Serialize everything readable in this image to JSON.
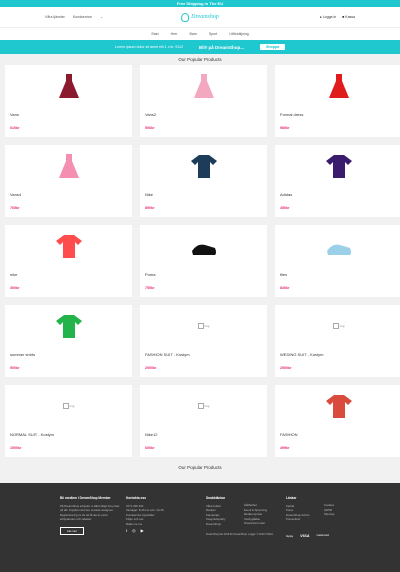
{
  "topbar": {
    "text": "Free Shipping in The EU"
  },
  "header": {
    "left": [
      "Våra tjänster",
      "Kundservice"
    ],
    "logo": "Dreamshop",
    "right": [
      "Logga in",
      "Kassa"
    ]
  },
  "nav": [
    "Start",
    "Herr",
    "Barn",
    "Sport",
    "Utförsäljning"
  ],
  "promo": {
    "text": "Lorem ipsum dolor sit amet elit 1 x kr. 9112",
    "title": "Bli# på DreamShop...",
    "button": "Shoppa"
  },
  "section_title": "Our Popular Products",
  "products": [
    {
      "name": "Vans",
      "price": "610kr",
      "icon": "dress-icon",
      "color": "#8b1a2f"
    },
    {
      "name": "Vans2",
      "price": "506kr",
      "icon": "dress-icon",
      "color": "#f3a8c0"
    },
    {
      "name": "Formal dress",
      "price": "980kr",
      "icon": "dress-icon",
      "color": "#e01b1b"
    },
    {
      "name": "Vans4",
      "price": "765kr",
      "icon": "dress-icon",
      "color": "#f48fb1"
    },
    {
      "name": "Nike",
      "price": "890kr",
      "icon": "shirt-icon",
      "color": "#1c3c5a"
    },
    {
      "name": "Adidas",
      "price": "450kr",
      "icon": "shirt-icon",
      "color": "#3a1c6e"
    },
    {
      "name": "nike",
      "price": "300kr",
      "icon": "shirt-icon",
      "color": "#ff4d4d"
    },
    {
      "name": "Puma",
      "price": "750kr",
      "icon": "shoe-icon",
      "color": "#111111"
    },
    {
      "name": "files",
      "price": "840kr",
      "icon": "shoe-icon",
      "color": "#9ad0e8"
    },
    {
      "name": "summer shirts",
      "price": "500kr",
      "icon": "shirt-icon",
      "color": "#22b44a"
    },
    {
      "name": "FASHION SUIT - Kostym",
      "price": "2000kr",
      "icon": "broken-image-icon",
      "alt": "img"
    },
    {
      "name": "WEDING SUIT - Kostym",
      "price": "2500kr",
      "icon": "broken-image-icon",
      "alt": "img"
    },
    {
      "name": "NORMAL SUIT - Kostym",
      "price": "1500kr",
      "icon": "broken-image-icon",
      "alt": "img"
    },
    {
      "name": "Nike12",
      "price": "600kr",
      "icon": "broken-image-icon",
      "alt": "img"
    },
    {
      "name": "FASHION",
      "price": "499kr",
      "icon": "shirt-icon",
      "color": "#d94c3d"
    }
  ],
  "bottom_title": "Our Popular Products",
  "footer": {
    "col1": {
      "title": "Bli medlem i DreamShop Member",
      "text": "På DreamShop erbjuder vi alltid riktigt bra priser på allt. Kopplat med den senaste designen. Registrera dig nu för att få del av extra erbjudanden och rabatter.",
      "button": "Läs mer"
    },
    "col2": {
      "title": "Kontakta oss",
      "lines": [
        "0771-400 400",
        "Vardagar: 8-20 Lör-sön: 10-18",
        "Kundservice öppettider",
        "Följer och oss",
        "Make me me"
      ]
    },
    "col3": {
      "title": "Snabblänkar",
      "lines": [
        "Våra butiker",
        "Mediem",
        "Kampanjer",
        "Integritetspolicy",
        "DreamShop"
      ]
    },
    "col4": {
      "title": "",
      "lines": [
        "Hållbarhet",
        "Event & Sponsring",
        "Medlemspriser",
        "Verktyglådan",
        "Dreamshot retail"
      ]
    },
    "col5": {
      "title": "Länkar",
      "lines": [
        "Karriär",
        "Press",
        "DreamShop Admin",
        "Presentkort"
      ]
    },
    "col6": {
      "title": "",
      "lines": [
        "Cookies",
        "GDPR",
        "Sitemap"
      ]
    },
    "copyright": "DreamShop Ab 2019 för DreamShop. Logga: © 2019 ©2019",
    "payments": [
      "Gpay",
      "VISA",
      "mastercard"
    ]
  }
}
